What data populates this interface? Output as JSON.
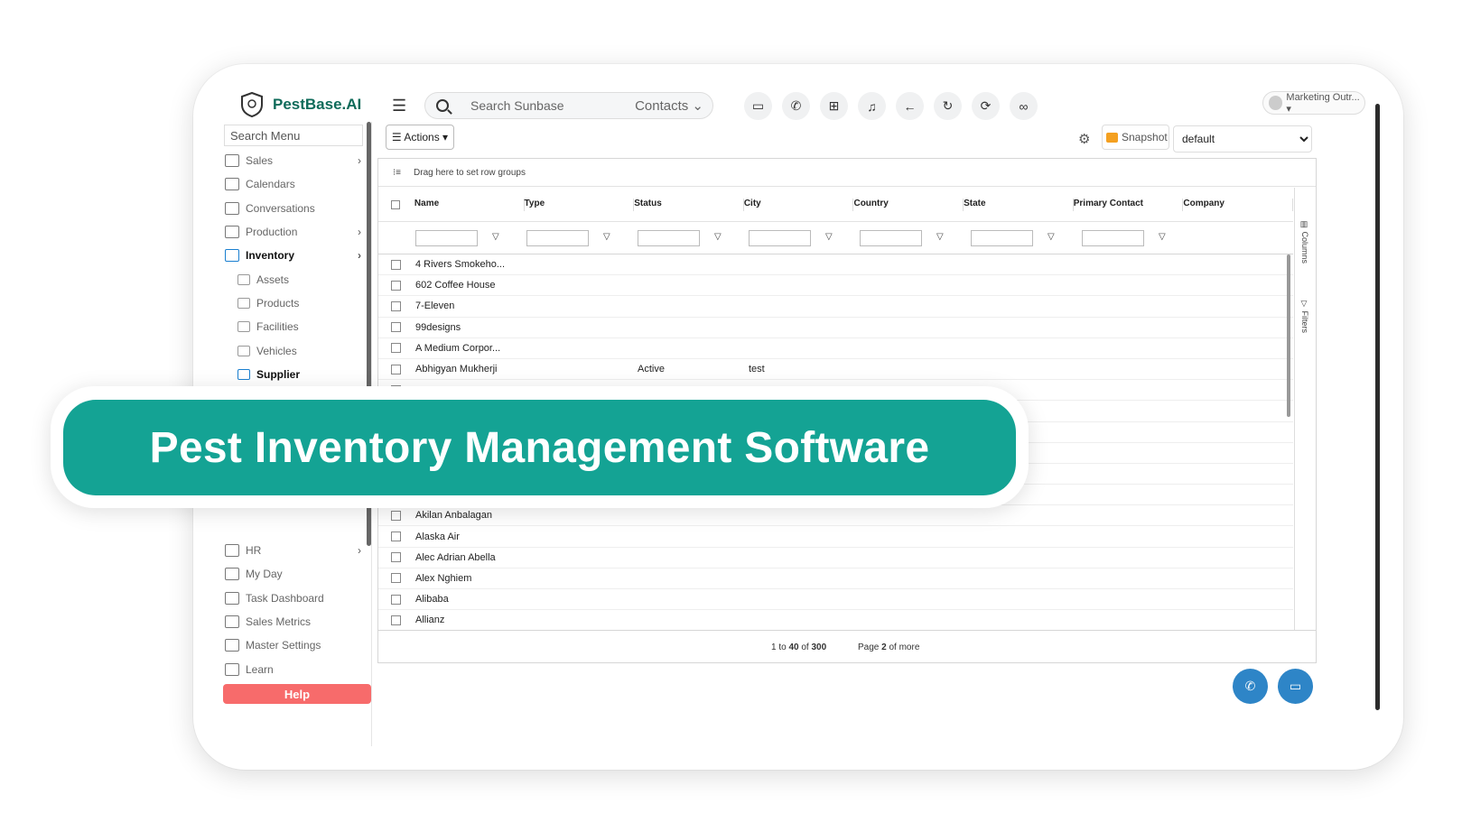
{
  "banner": {
    "title": "Pest Inventory Management Software"
  },
  "topbar": {
    "logo_name": "PestBase.AI",
    "search_placeholder": "Search Sunbase",
    "search_scope": "Contacts ⌄",
    "icons": [
      "chat-icon",
      "phone-icon",
      "add-box-icon",
      "bell-icon",
      "back-arrow-icon",
      "refresh-dot-icon",
      "sync-icon",
      "glasses-icon"
    ],
    "user_label": "Marketing Outr... ▾"
  },
  "sidebar": {
    "search_placeholder": "Search Menu",
    "items": [
      {
        "label": "Sales",
        "chevron": true
      },
      {
        "label": "Calendars"
      },
      {
        "label": "Conversations"
      },
      {
        "label": "Production",
        "chevron": true
      },
      {
        "label": "Inventory",
        "chevron": true,
        "active": true
      },
      {
        "label": "Assets",
        "sub": true
      },
      {
        "label": "Products",
        "sub": true
      },
      {
        "label": "Facilities",
        "sub": true
      },
      {
        "label": "Vehicles",
        "sub": true
      },
      {
        "label": "Supplier",
        "sub": true,
        "active": true
      }
    ],
    "items_bottom": [
      {
        "label": "HR",
        "chevron": true
      },
      {
        "label": "My Day"
      },
      {
        "label": "Task Dashboard"
      },
      {
        "label": "Sales Metrics"
      },
      {
        "label": "Master Settings"
      },
      {
        "label": "Learn"
      }
    ],
    "help_label": "Help"
  },
  "toolbar": {
    "actions_label": "☰ Actions ▾",
    "snapshot_label": "Snapshot",
    "view_value": "default"
  },
  "grid": {
    "group_hint": "Drag here to set row groups",
    "columns": [
      "Name",
      "Type",
      "Status",
      "City",
      "Country",
      "State",
      "Primary Contact",
      "Company"
    ],
    "rows_top": [
      {
        "name": "4 Rivers Smokeho...",
        "status": "",
        "city": ""
      },
      {
        "name": "602 Coffee House",
        "status": "",
        "city": ""
      },
      {
        "name": "7-Eleven",
        "status": "",
        "city": ""
      },
      {
        "name": "99designs",
        "status": "",
        "city": ""
      },
      {
        "name": "A Medium Corpor...",
        "status": "",
        "city": ""
      },
      {
        "name": "Abhigyan Mukherji",
        "status": "Active",
        "city": "test"
      }
    ],
    "rows_bottom": [
      {
        "name": "Akilan Anbalagan"
      },
      {
        "name": "Alaska Air"
      },
      {
        "name": "Alec Adrian Abella"
      },
      {
        "name": "Alex Nghiem"
      },
      {
        "name": "Alibaba"
      },
      {
        "name": "Allianz"
      }
    ],
    "side_tabs": [
      "Columns",
      "Filters"
    ],
    "pager_range_prefix": "1 to",
    "pager_range_to": "40",
    "pager_range_of": "of",
    "pager_total": "300",
    "pager_page_prefix": "Page",
    "pager_page": "2",
    "pager_page_suffix": "of more"
  },
  "colors": {
    "brand": "#14a394",
    "help": "#f76b6b",
    "fab": "#2e85c7"
  }
}
